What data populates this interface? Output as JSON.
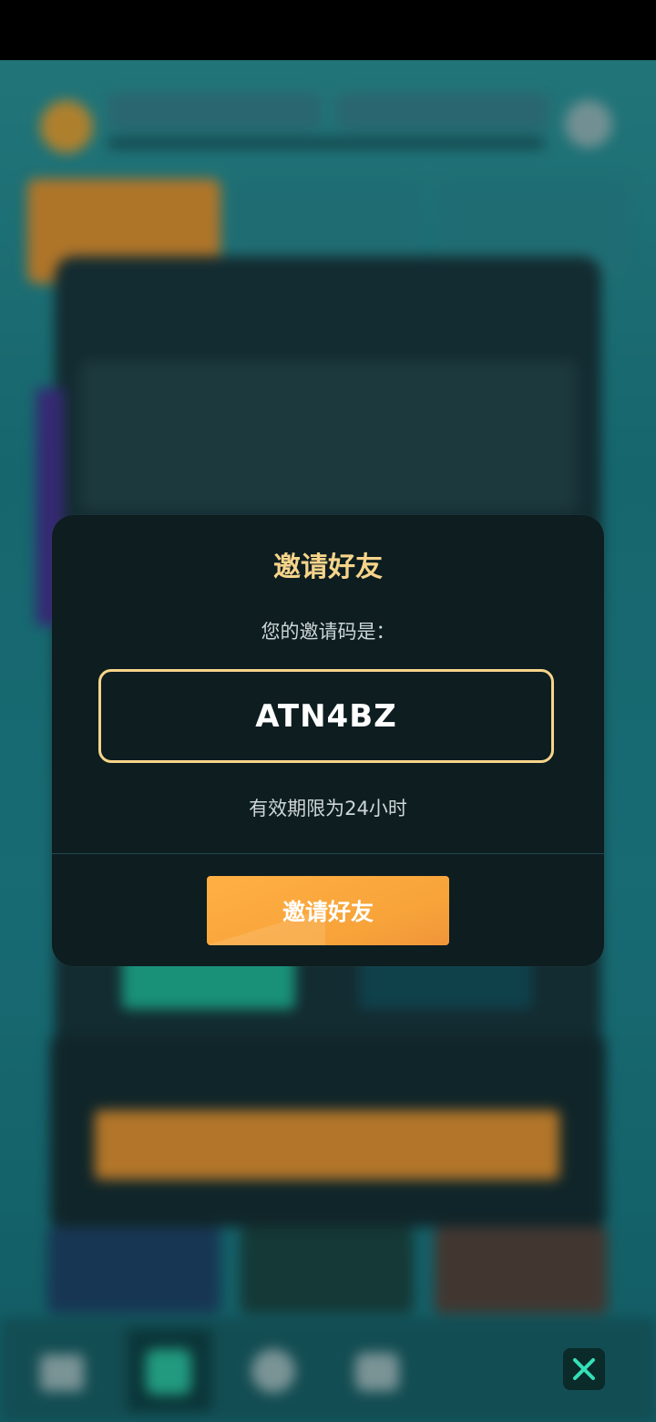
{
  "modal": {
    "title": "邀请好友",
    "subtitle": "您的邀请码是：",
    "invite_code": "ATN4BZ",
    "validity": "有效期限为24小时",
    "invite_button_label": "邀请好友"
  },
  "close_button": {
    "icon": "close-icon"
  },
  "colors": {
    "accent_gold": "#f6d48a",
    "button_orange": "#f7a33a",
    "modal_bg": "#0d1d20",
    "close_x": "#34e0b6"
  }
}
